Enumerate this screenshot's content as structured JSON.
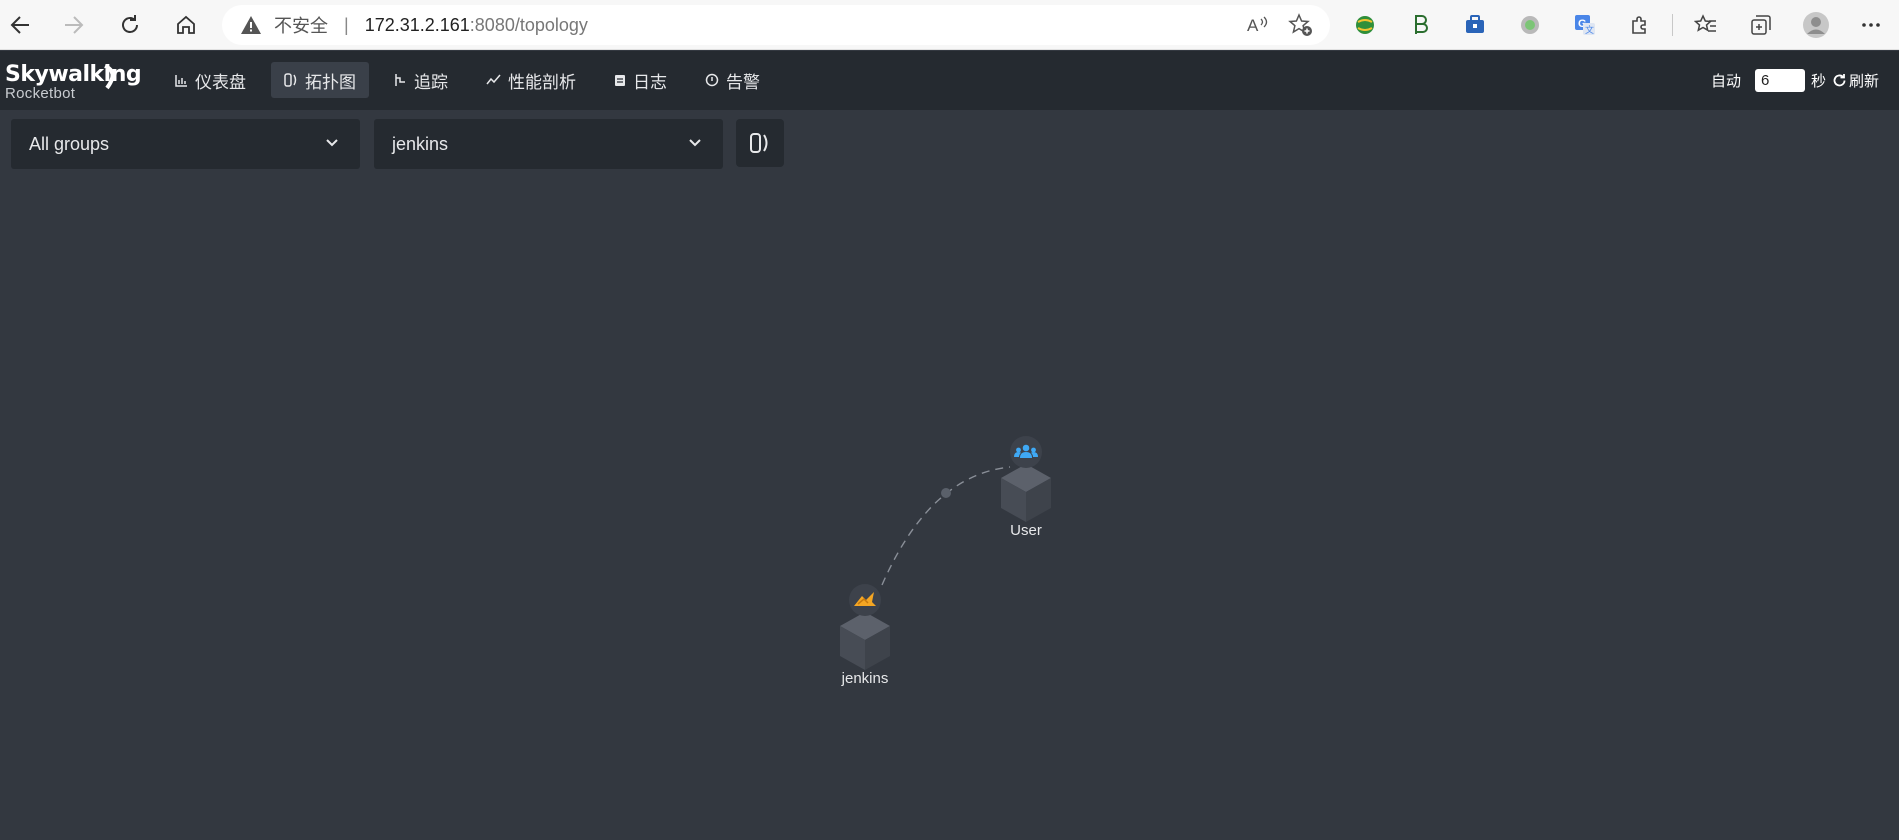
{
  "browser": {
    "insecure_label": "不安全",
    "separator": "|",
    "url_host": "172.31.2.161",
    "url_path": ":8080/topology"
  },
  "app": {
    "logo_main": "Skywalking",
    "logo_sub": "Rocketbot",
    "menu": [
      {
        "label": "仪表盘",
        "icon": "dashboard-icon",
        "active": false
      },
      {
        "label": "拓扑图",
        "icon": "topology-icon",
        "active": true
      },
      {
        "label": "追踪",
        "icon": "trace-icon",
        "active": false
      },
      {
        "label": "性能剖析",
        "icon": "profile-icon",
        "active": false
      },
      {
        "label": "日志",
        "icon": "log-icon",
        "active": false
      },
      {
        "label": "告警",
        "icon": "alarm-icon",
        "active": false
      }
    ],
    "auto_label": "自动",
    "auto_seconds": "6",
    "seconds_unit": "秒",
    "refresh_label": "刷新"
  },
  "toolbar": {
    "group_select": "All groups",
    "service_select": "jenkins"
  },
  "topology": {
    "nodes": [
      {
        "name": "User",
        "type": "user",
        "icon": "users-icon",
        "icon_color": "#3fa9f5"
      },
      {
        "name": "jenkins",
        "type": "service",
        "icon": "jenkins-icon",
        "icon_color": "#f5a623"
      }
    ],
    "edges": [
      {
        "source": "jenkins",
        "target": "User"
      }
    ]
  },
  "colors": {
    "background": "#333840",
    "header": "#252a30",
    "node": "#4a4f58"
  }
}
